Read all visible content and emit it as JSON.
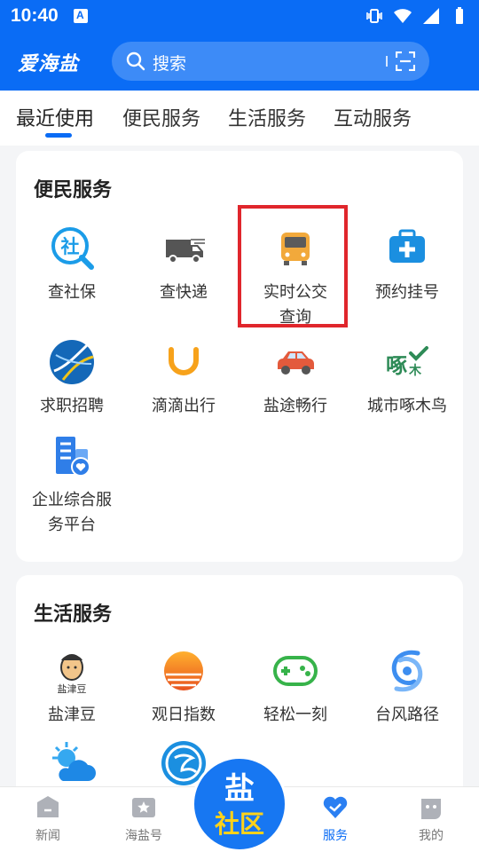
{
  "status_bar": {
    "time": "10:40"
  },
  "header": {
    "logo": "爱海盐",
    "search_placeholder": "搜索"
  },
  "tabs": [
    "最近使用",
    "便民服务",
    "生活服务",
    "互动服务"
  ],
  "sections": [
    {
      "title": "便民服务",
      "items": [
        {
          "label": "查社保",
          "icon": "social-security-icon"
        },
        {
          "label": "查快递",
          "icon": "delivery-truck-icon"
        },
        {
          "label": "实时公交查询",
          "icon": "bus-icon"
        },
        {
          "label": "预约挂号",
          "icon": "medical-kit-icon"
        },
        {
          "label": "求职招聘",
          "icon": "job-globe-icon"
        },
        {
          "label": "滴滴出行",
          "icon": "didi-icon"
        },
        {
          "label": "盐途畅行",
          "icon": "car-icon"
        },
        {
          "label": "城市啄木鸟",
          "icon": "woodpecker-icon"
        },
        {
          "label": "企业综合服务平台",
          "icon": "enterprise-building-icon"
        }
      ]
    },
    {
      "title": "生活服务",
      "items": [
        {
          "label": "盐津豆",
          "icon": "yanjindou-mascot-icon"
        },
        {
          "label": "观日指数",
          "icon": "sunrise-icon"
        },
        {
          "label": "轻松一刻",
          "icon": "gamepad-icon"
        },
        {
          "label": "台风路径",
          "icon": "typhoon-icon"
        },
        {
          "label": "",
          "icon": "weather-icon"
        },
        {
          "label": "",
          "icon": "circle-brand-icon"
        }
      ]
    }
  ],
  "bottom_nav": {
    "items": [
      "新闻",
      "海盐号",
      "服务",
      "我的"
    ],
    "center_top": "盐",
    "center_bottom": "社区",
    "active": "服务"
  },
  "colors": {
    "brand": "#0a6cf5",
    "highlight": "#e0262c",
    "accent_yellow": "#ffd21a"
  }
}
